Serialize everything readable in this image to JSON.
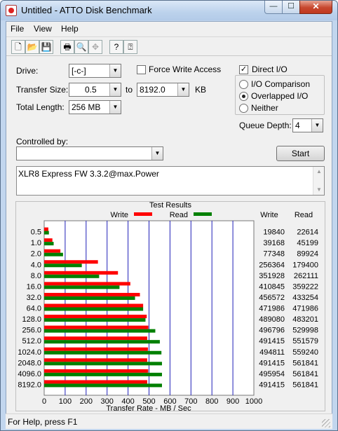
{
  "window": {
    "title": "Untitled - ATTO Disk Benchmark",
    "minimize": "—",
    "maximize": "☐",
    "close": "✕"
  },
  "menu": [
    "File",
    "View",
    "Help"
  ],
  "toolbar": [
    "new-icon",
    "open-icon",
    "save-icon",
    "print-icon",
    "print-preview-icon",
    "move-icon",
    "help-icon",
    "context-help-icon"
  ],
  "drive": {
    "label": "Drive:",
    "value": "[-c-]"
  },
  "force_write": {
    "label": "Force Write Access",
    "checked": false
  },
  "direct_io": {
    "label": "Direct I/O",
    "checked": true
  },
  "transfer_size": {
    "label": "Transfer Size:",
    "from": "0.5",
    "to_label": "to",
    "to": "8192.0",
    "unit": "KB"
  },
  "total_length": {
    "label": "Total Length:",
    "value": "256 MB"
  },
  "io_mode": {
    "options": [
      "I/O Comparison",
      "Overlapped I/O",
      "Neither"
    ],
    "selected": "Overlapped I/O"
  },
  "queue_depth": {
    "label": "Queue Depth:",
    "value": "4"
  },
  "controlled_by": {
    "label": "Controlled by:",
    "value": ""
  },
  "start_button": "Start",
  "description": "XLR8 Express FW 3.3.2@max.Power",
  "results": {
    "title": "Test Results",
    "legend": {
      "write": "Write",
      "read": "Read"
    },
    "col_write": "Write",
    "col_read": "Read",
    "rows": [
      {
        "size": "0.5",
        "write": "19840",
        "read": "22614"
      },
      {
        "size": "1.0",
        "write": "39168",
        "read": "45199"
      },
      {
        "size": "2.0",
        "write": "77348",
        "read": "89924"
      },
      {
        "size": "4.0",
        "write": "256364",
        "read": "179400"
      },
      {
        "size": "8.0",
        "write": "351928",
        "read": "262111"
      },
      {
        "size": "16.0",
        "write": "410845",
        "read": "359222"
      },
      {
        "size": "32.0",
        "write": "456572",
        "read": "433254"
      },
      {
        "size": "64.0",
        "write": "471986",
        "read": "471986"
      },
      {
        "size": "128.0",
        "write": "489080",
        "read": "483201"
      },
      {
        "size": "256.0",
        "write": "496796",
        "read": "529998"
      },
      {
        "size": "512.0",
        "write": "491415",
        "read": "551579"
      },
      {
        "size": "1024.0",
        "write": "494811",
        "read": "559240"
      },
      {
        "size": "2048.0",
        "write": "491415",
        "read": "561841"
      },
      {
        "size": "4096.0",
        "write": "495954",
        "read": "561841"
      },
      {
        "size": "8192.0",
        "write": "491415",
        "read": "561841"
      }
    ]
  },
  "chart_data": {
    "type": "bar",
    "orientation": "horizontal",
    "categories": [
      "0.5",
      "1.0",
      "2.0",
      "4.0",
      "8.0",
      "16.0",
      "32.0",
      "64.0",
      "128.0",
      "256.0",
      "512.0",
      "1024.0",
      "2048.0",
      "4096.0",
      "8192.0"
    ],
    "series": [
      {
        "name": "Write",
        "color": "#ff0000",
        "values": [
          19.8,
          39.2,
          77.3,
          256.4,
          351.9,
          410.8,
          456.6,
          472.0,
          489.1,
          496.8,
          491.4,
          494.8,
          491.4,
          496.0,
          491.4
        ]
      },
      {
        "name": "Read",
        "color": "#008000",
        "values": [
          22.6,
          45.2,
          89.9,
          179.4,
          262.1,
          359.2,
          433.3,
          472.0,
          483.2,
          530.0,
          551.6,
          559.2,
          561.8,
          561.8,
          561.8
        ]
      }
    ],
    "xlabel": "Transfer Rate - MB / Sec",
    "xlim": [
      0,
      1000
    ],
    "xticks": [
      "0",
      "100",
      "200",
      "300",
      "400",
      "500",
      "600",
      "700",
      "800",
      "900",
      "1000"
    ],
    "grid": true,
    "legend_position": "top"
  },
  "status": "For Help, press F1"
}
